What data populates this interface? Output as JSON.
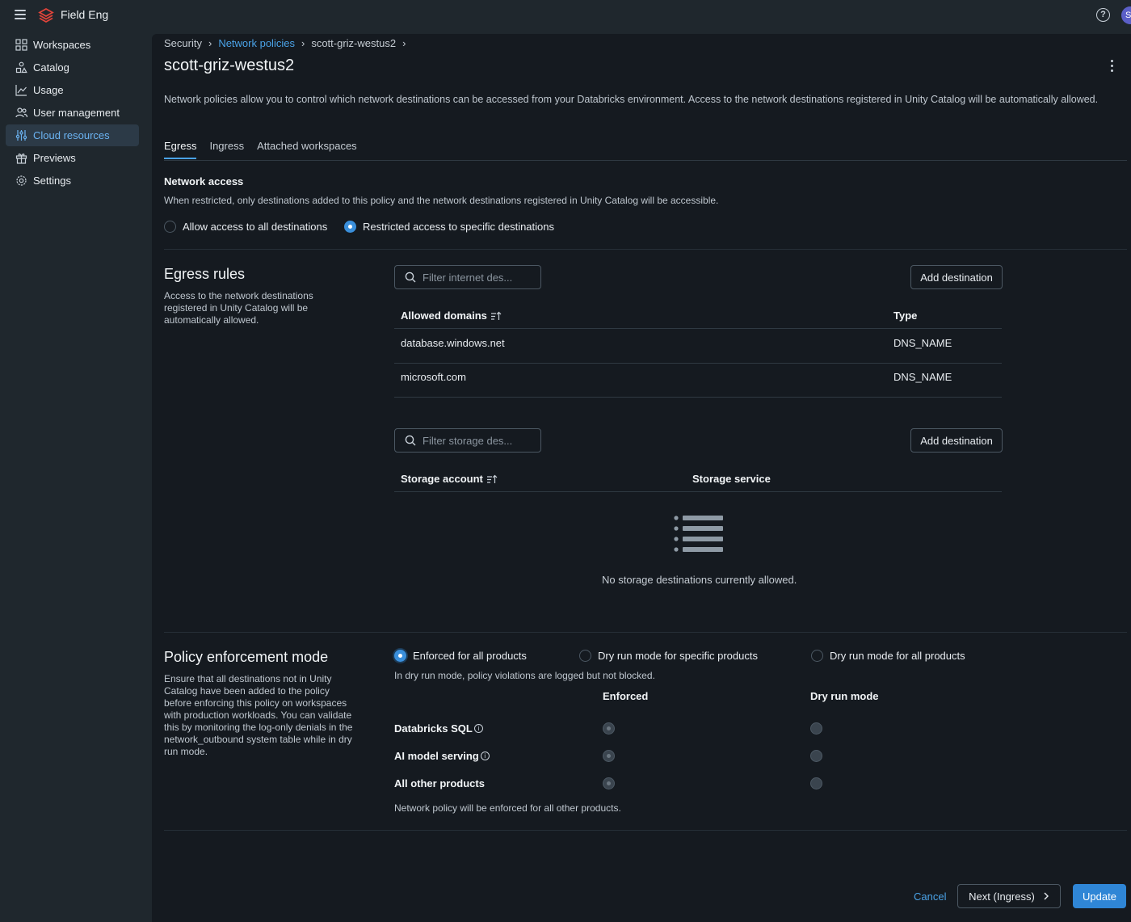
{
  "app": {
    "workspace_name": "Field Eng",
    "avatar_initial": "S",
    "help_symbol": "?"
  },
  "sidebar": {
    "items": [
      {
        "label": "Workspaces",
        "icon": "workspaces-icon"
      },
      {
        "label": "Catalog",
        "icon": "catalog-icon"
      },
      {
        "label": "Usage",
        "icon": "usage-chart-icon"
      },
      {
        "label": "User management",
        "icon": "users-icon"
      },
      {
        "label": "Cloud resources",
        "icon": "cloud-resources-icon",
        "active": true
      },
      {
        "label": "Previews",
        "icon": "gift-icon"
      },
      {
        "label": "Settings",
        "icon": "gear-icon"
      }
    ]
  },
  "breadcrumb": {
    "items": [
      "Security",
      "Network policies",
      "scott-griz-westus2"
    ],
    "separator": "›"
  },
  "page": {
    "title": "scott-griz-westus2",
    "description": "Network policies allow you to control which network destinations can be accessed from your Databricks environment. Access to the network destinations registered in Unity Catalog will be automatically allowed."
  },
  "tabs": [
    {
      "label": "Egress",
      "active": true
    },
    {
      "label": "Ingress"
    },
    {
      "label": "Attached workspaces"
    }
  ],
  "network_access": {
    "heading": "Network access",
    "description": "When restricted, only destinations added to this policy and the network destinations registered in Unity Catalog will be accessible.",
    "options": [
      {
        "label": "Allow access to all destinations",
        "selected": false
      },
      {
        "label": "Restricted access to specific destinations",
        "selected": true
      }
    ]
  },
  "egress_rules": {
    "title": "Egress rules",
    "description": "Access to the network destinations registered in Unity Catalog will be automatically allowed.",
    "internet": {
      "search_placeholder": "Filter internet des...",
      "add_label": "Add destination",
      "columns": [
        "Allowed domains",
        "Type"
      ],
      "rows": [
        {
          "domain": "database.windows.net",
          "type": "DNS_NAME"
        },
        {
          "domain": "microsoft.com",
          "type": "DNS_NAME"
        }
      ]
    },
    "storage": {
      "search_placeholder": "Filter storage des...",
      "add_label": "Add destination",
      "columns": [
        "Storage account",
        "Storage service"
      ],
      "empty_text": "No storage destinations currently allowed."
    }
  },
  "enforcement": {
    "title": "Policy enforcement mode",
    "description": "Ensure that all destinations not in Unity Catalog have been added to the policy before enforcing this policy on workspaces with production workloads. You can validate this by monitoring the log-only denials in the network_outbound system table while in dry run mode.",
    "modes": [
      {
        "label": "Enforced for all products",
        "selected": true
      },
      {
        "label": "Dry run mode for specific products",
        "selected": false
      },
      {
        "label": "Dry run mode for all products",
        "selected": false
      }
    ],
    "hint": "In dry run mode, policy violations are logged but not blocked.",
    "columns": [
      "Enforced",
      "Dry run mode"
    ],
    "products": [
      {
        "name": "Databricks SQL",
        "info": true,
        "enforced": true
      },
      {
        "name": "AI model serving",
        "info": true,
        "enforced": true
      },
      {
        "name": "All other products",
        "info": false,
        "enforced": true
      }
    ],
    "footnote": "Network policy will be enforced for all other products."
  },
  "footer": {
    "cancel": "Cancel",
    "next": "Next (Ingress)",
    "update": "Update"
  },
  "colors": {
    "accent": "#4aa2e6",
    "primary_button": "#2f86d6",
    "background": "#151a20",
    "sidebar": "#1f272d"
  }
}
